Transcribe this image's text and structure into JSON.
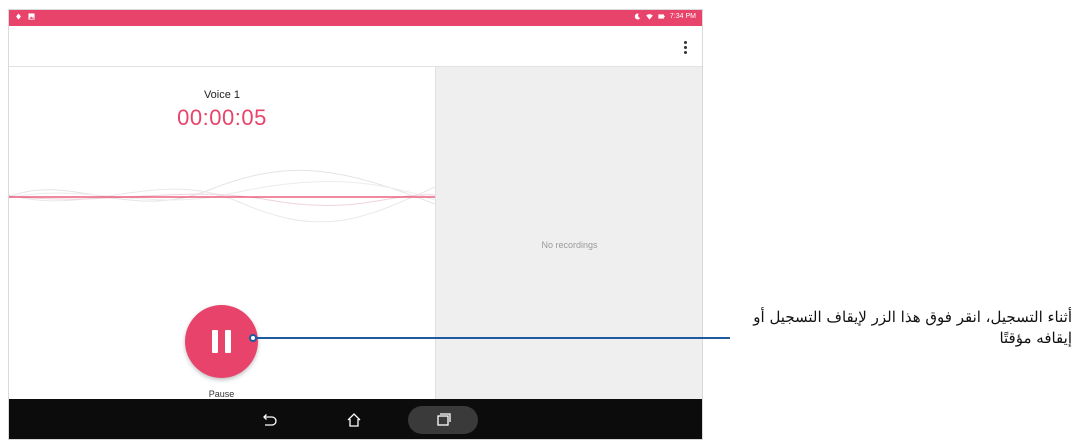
{
  "status_bar": {
    "time": "7:34 PM",
    "icons": [
      "notification-icon",
      "image-icon",
      "moon-icon",
      "wifi-icon",
      "battery-icon"
    ]
  },
  "app_bar": {
    "menu_icon": "more-vert-icon"
  },
  "recorder": {
    "recording_name": "Voice 1",
    "elapsed_time": "00:00:05",
    "pause_label": "Pause"
  },
  "recordings_panel": {
    "empty_text": "No recordings"
  },
  "nav_bar": {
    "icons": [
      "back-icon",
      "home-icon",
      "recents-icon"
    ]
  },
  "callout": {
    "text": "أثناء التسجيل، انقر فوق هذا الزر لإيقاف التسجيل أو إيقافه مؤقتًا"
  },
  "colors": {
    "accent": "#e8436b",
    "callout_line": "#1e5aa0",
    "nav_bar": "#0c0c0c",
    "right_pane": "#efefef"
  }
}
